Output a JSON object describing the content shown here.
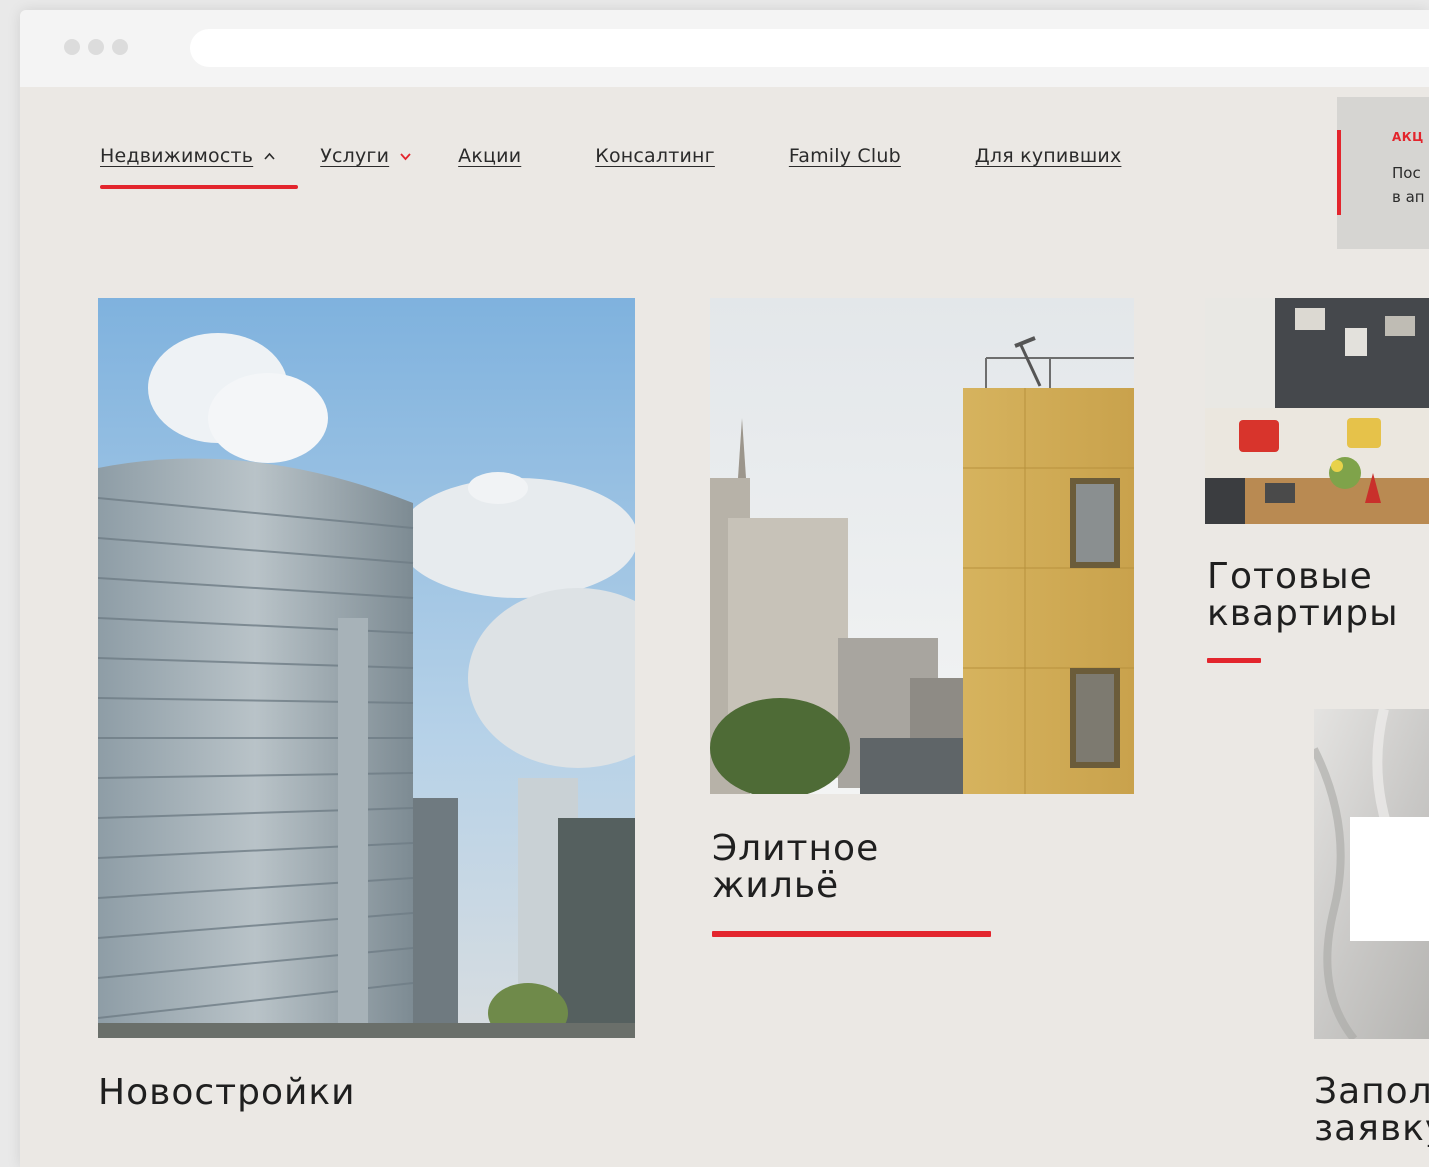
{
  "browser": {
    "window_dots": 3,
    "dot_color": "#dcdcdc"
  },
  "colors": {
    "accent": "#e3252d",
    "page_bg": "#ebe8e4",
    "text": "#1f1f1f"
  },
  "nav": {
    "items": [
      {
        "label": "Недвижимость",
        "caret": "chevron-up-icon",
        "active": true
      },
      {
        "label": "Услуги",
        "caret": "chevron-down-icon",
        "active": false
      },
      {
        "label": "Акции",
        "caret": null,
        "active": false
      },
      {
        "label": "Консалтинг",
        "caret": null,
        "active": false
      },
      {
        "label": "Family Club",
        "caret": null,
        "active": false
      },
      {
        "label": "Для купивших",
        "caret": null,
        "active": false
      }
    ]
  },
  "promo": {
    "tag": "АКЦ",
    "line1": "Пос",
    "line2": "в ап"
  },
  "cards": [
    {
      "title": "Новостройки",
      "image": "highrise-building-photo"
    },
    {
      "title": "Элитное\nжильё",
      "image": "golden-facade-photo"
    },
    {
      "title": "Готовые\nквартиры",
      "image": "living-room-interior-photo"
    },
    {
      "title": "Запол\nзаявку",
      "image": "fabric-and-card-photo"
    }
  ]
}
